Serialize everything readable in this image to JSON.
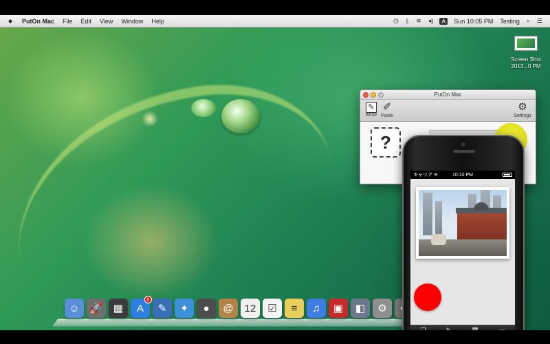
{
  "menubar": {
    "apple_icon": "apple-logo",
    "app_name": "PutOn Mac",
    "menus": [
      "File",
      "Edit",
      "View",
      "Window",
      "Help"
    ],
    "status_icons": [
      "time-machine-icon",
      "bluetooth-icon",
      "wifi-icon",
      "volume-icon",
      "input-source-icon"
    ],
    "input_source": "A",
    "clock": "Sun 10:05 PM",
    "user": "Testing",
    "spotlight_icon": "search-icon",
    "notification_icon": "list-icon"
  },
  "desktop": {
    "file": {
      "name_line1": "Screen Shot",
      "name_line2": "2013...0 PM"
    }
  },
  "window": {
    "title": "PutOn Mac",
    "toolbar": {
      "write_label": "Write",
      "paste_label": "Paste",
      "settings_label": "Settings"
    },
    "placeholder_glyph": "?"
  },
  "dock": {
    "items": [
      {
        "name": "finder",
        "glyph": "☺",
        "color": "#5a8fd8"
      },
      {
        "name": "launchpad",
        "glyph": "🚀",
        "color": "#6e6e6e"
      },
      {
        "name": "mission-control",
        "glyph": "▦",
        "color": "#3b3b3b"
      },
      {
        "name": "app-store",
        "glyph": "A",
        "color": "#2f7fe0",
        "badge": "5"
      },
      {
        "name": "preview",
        "glyph": "✎",
        "color": "#3a6fb5"
      },
      {
        "name": "safari",
        "glyph": "✦",
        "color": "#3d8fd9"
      },
      {
        "name": "facetime",
        "glyph": "●",
        "color": "#4d4d4d"
      },
      {
        "name": "contacts",
        "glyph": "@",
        "color": "#b08445"
      },
      {
        "name": "calendar",
        "glyph": "12",
        "color": "#f0f0f0"
      },
      {
        "name": "reminders",
        "glyph": "☑",
        "color": "#f5f5f5"
      },
      {
        "name": "notes",
        "glyph": "≡",
        "color": "#e9cf5a"
      },
      {
        "name": "itunes",
        "glyph": "♫",
        "color": "#3d7ee0"
      },
      {
        "name": "photo-booth",
        "glyph": "▣",
        "color": "#c62a2a"
      },
      {
        "name": "iphoto",
        "glyph": "◧",
        "color": "#6b7a8a"
      },
      {
        "name": "system-preferences",
        "glyph": "⚙",
        "color": "#8e8e8e"
      },
      {
        "name": "trash",
        "glyph": "♻",
        "color": "#7a7a7a"
      }
    ]
  },
  "iphone": {
    "carrier": "キャリア",
    "time": "10:10 PM",
    "battery_level": 0.85,
    "toolbar_icons": [
      "copy-icon",
      "compose-icon",
      "trash-icon",
      "ruler-icon"
    ]
  }
}
